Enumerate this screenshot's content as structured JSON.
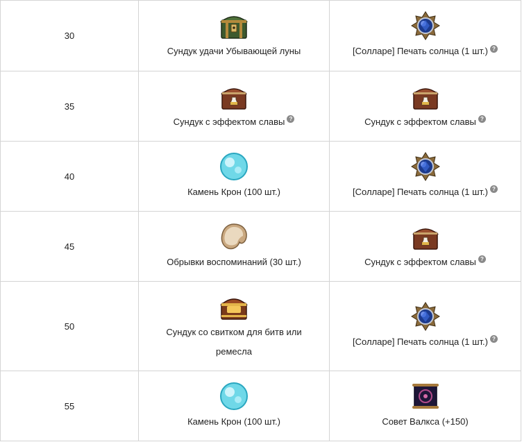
{
  "rows": [
    {
      "level": "30",
      "r1": {
        "icon": "green-lucky-chest-icon",
        "name": "Сундук удачи Убывающей луны",
        "help": false
      },
      "r2": {
        "icon": "sun-seal-icon",
        "name": "[Солларе] Печать солнца (1 шт.)",
        "help": true
      }
    },
    {
      "level": "35",
      "r1": {
        "icon": "glory-chest-icon",
        "name": "Сундук с эффектом славы",
        "help": true
      },
      "r2": {
        "icon": "glory-chest-icon",
        "name": "Сундук с эффектом славы",
        "help": true
      }
    },
    {
      "level": "40",
      "r1": {
        "icon": "crown-stone-icon",
        "name": "Камень Крон (100 шт.)",
        "help": false
      },
      "r2": {
        "icon": "sun-seal-icon",
        "name": "[Солларе] Печать солнца (1 шт.)",
        "help": true
      }
    },
    {
      "level": "45",
      "r1": {
        "icon": "memory-scraps-icon",
        "name": "Обрывки воспоминаний (30 шт.)",
        "help": false
      },
      "r2": {
        "icon": "glory-chest-icon",
        "name": "Сундук с эффектом славы",
        "help": true
      }
    },
    {
      "level": "50",
      "r1": {
        "icon": "scroll-chest-icon",
        "name_line1": "Сундук со свитком для битв или",
        "name_line2": "ремесла",
        "help": false
      },
      "r2": {
        "icon": "sun-seal-icon",
        "name": "[Солларе] Печать солнца (1 шт.)",
        "help": true
      }
    },
    {
      "level": "55",
      "r1": {
        "icon": "crown-stone-icon",
        "name": "Камень Крон (100 шт.)",
        "help": false
      },
      "r2": {
        "icon": "valka-advice-scroll-icon",
        "name": "Совет Валкса (+150)",
        "help": false
      }
    }
  ],
  "help_glyph": "?"
}
